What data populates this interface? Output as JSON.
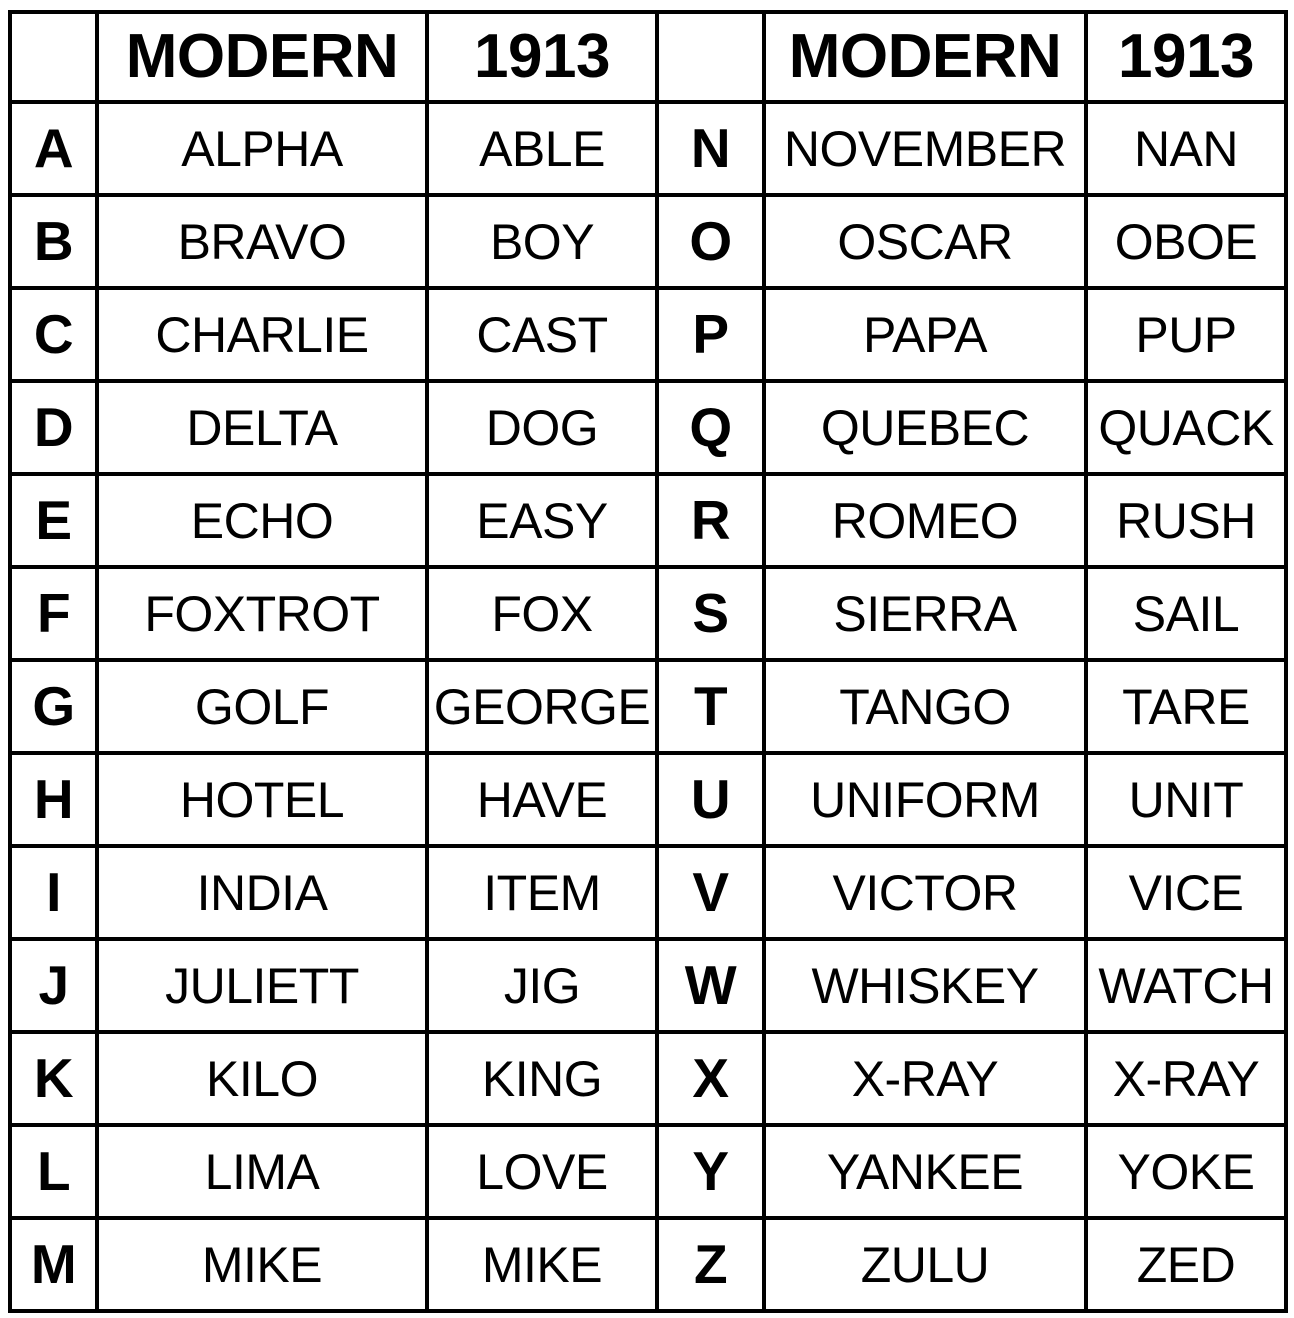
{
  "table": {
    "headers": {
      "letter_left": "",
      "modern_left": "MODERN",
      "year_left": "1913",
      "letter_right": "",
      "modern_right": "MODERN",
      "year_right": "1913"
    },
    "rows": [
      {
        "letter_left": "A",
        "modern_left": "ALPHA",
        "year_left": "ABLE",
        "letter_right": "N",
        "modern_right": "NOVEMBER",
        "year_right": "NAN"
      },
      {
        "letter_left": "B",
        "modern_left": "BRAVO",
        "year_left": "BOY",
        "letter_right": "O",
        "modern_right": "OSCAR",
        "year_right": "OBOE"
      },
      {
        "letter_left": "C",
        "modern_left": "CHARLIE",
        "year_left": "CAST",
        "letter_right": "P",
        "modern_right": "PAPA",
        "year_right": "PUP"
      },
      {
        "letter_left": "D",
        "modern_left": "DELTA",
        "year_left": "DOG",
        "letter_right": "Q",
        "modern_right": "QUEBEC",
        "year_right": "QUACK"
      },
      {
        "letter_left": "E",
        "modern_left": "ECHO",
        "year_left": "EASY",
        "letter_right": "R",
        "modern_right": "ROMEO",
        "year_right": "RUSH"
      },
      {
        "letter_left": "F",
        "modern_left": "FOXTROT",
        "year_left": "FOX",
        "letter_right": "S",
        "modern_right": "SIERRA",
        "year_right": "SAIL"
      },
      {
        "letter_left": "G",
        "modern_left": "GOLF",
        "year_left": "GEORGE",
        "letter_right": "T",
        "modern_right": "TANGO",
        "year_right": "TARE"
      },
      {
        "letter_left": "H",
        "modern_left": "HOTEL",
        "year_left": "HAVE",
        "letter_right": "U",
        "modern_right": "UNIFORM",
        "year_right": "UNIT"
      },
      {
        "letter_left": "I",
        "modern_left": "INDIA",
        "year_left": "ITEM",
        "letter_right": "V",
        "modern_right": "VICTOR",
        "year_right": "VICE"
      },
      {
        "letter_left": "J",
        "modern_left": "JULIETT",
        "year_left": "JIG",
        "letter_right": "W",
        "modern_right": "WHISKEY",
        "year_right": "WATCH"
      },
      {
        "letter_left": "K",
        "modern_left": "KILO",
        "year_left": "KING",
        "letter_right": "X",
        "modern_right": "X-RAY",
        "year_right": "X-RAY"
      },
      {
        "letter_left": "L",
        "modern_left": "LIMA",
        "year_left": "LOVE",
        "letter_right": "Y",
        "modern_right": "YANKEE",
        "year_right": "YOKE"
      },
      {
        "letter_left": "M",
        "modern_left": "MIKE",
        "year_left": "MIKE",
        "letter_right": "Z",
        "modern_right": "ZULU",
        "year_right": "ZED"
      }
    ]
  },
  "colors": {
    "border": "#000000",
    "background": "#ffffff",
    "text": "#000000"
  }
}
